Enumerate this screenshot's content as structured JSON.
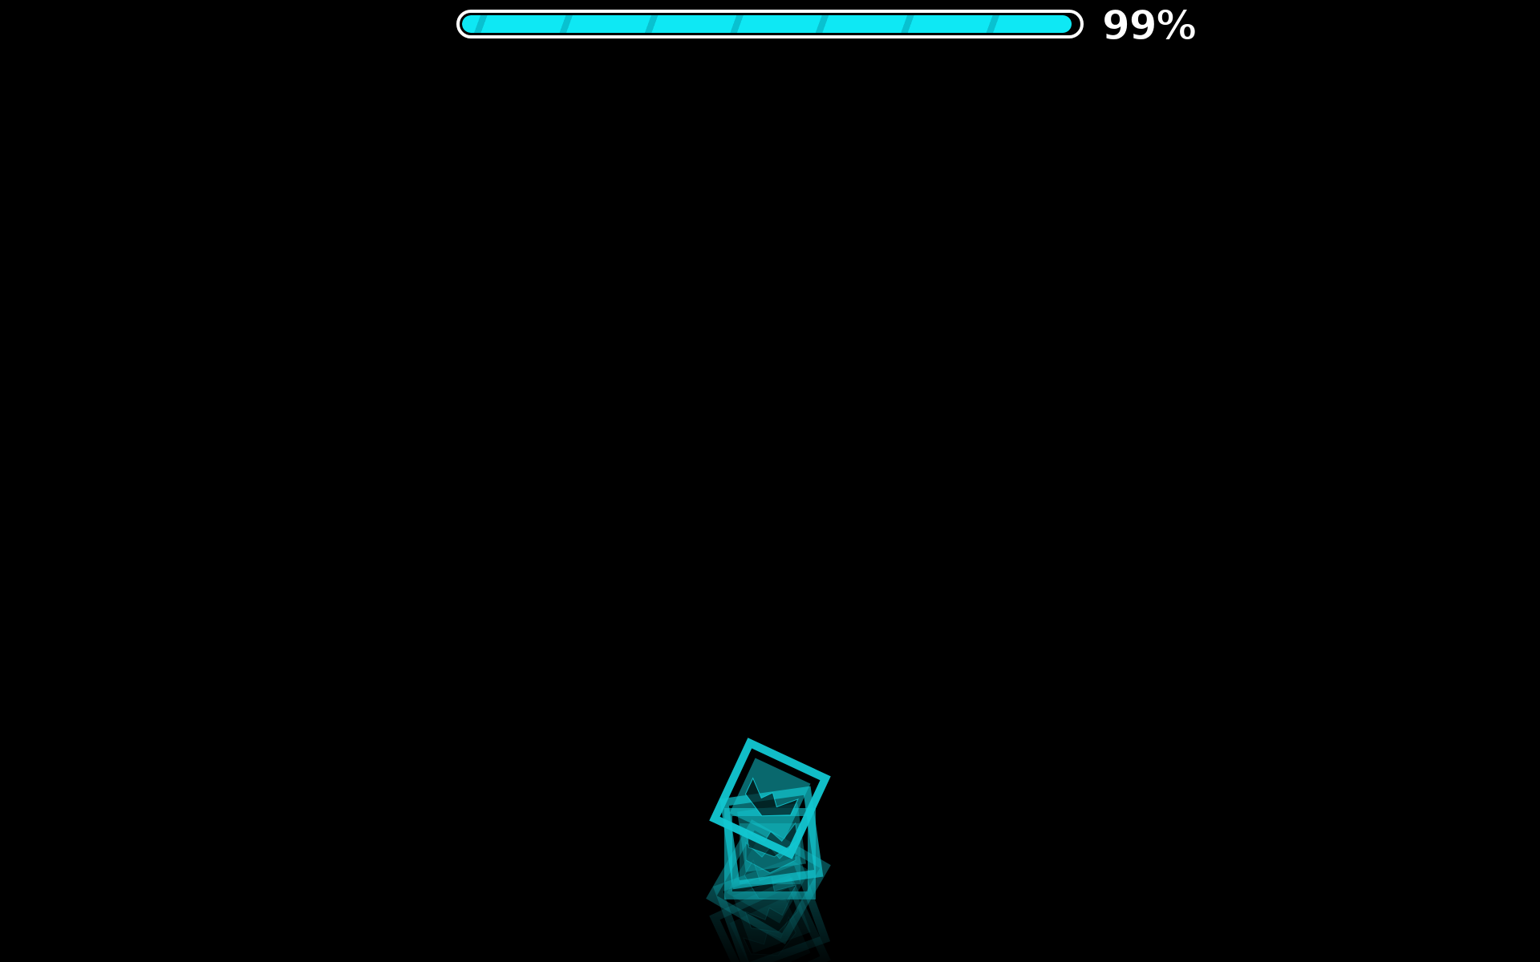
{
  "hud": {
    "progress_value": 99,
    "progress_text": "99%",
    "bar_color": "#0ee8f4",
    "bar_border_color": "#ffffff"
  },
  "scene": {
    "background_color": "#000000",
    "player_color": "#12c8d2",
    "player_icon": "cube-icon"
  }
}
